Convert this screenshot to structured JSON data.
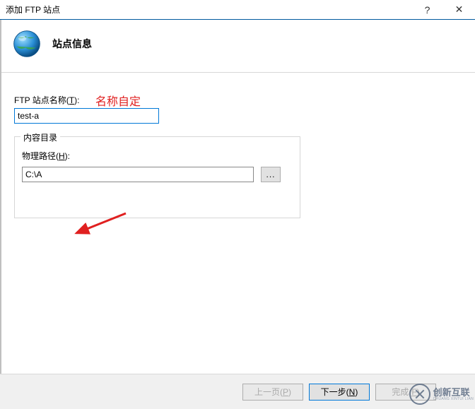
{
  "titlebar": {
    "title": "添加 FTP 站点",
    "help": "?",
    "close": "✕"
  },
  "header": {
    "title": "站点信息"
  },
  "annotation": "名称自定",
  "site_name": {
    "label_prefix": "FTP 站点名称(",
    "label_key": "T",
    "label_suffix": "):",
    "value": "test-a"
  },
  "content_dir": {
    "legend": "内容目录",
    "path_label_prefix": "物理路径(",
    "path_label_key": "H",
    "path_label_suffix": "):",
    "path_value": "C:\\A",
    "browse": "..."
  },
  "footer": {
    "prev_prefix": "上一页(",
    "prev_key": "P",
    "prev_suffix": ")",
    "next_prefix": "下一步(",
    "next_key": "N",
    "next_suffix": ")",
    "finish_prefix": "完成(",
    "finish_key": "F",
    "finish_suffix": ")"
  },
  "watermark": {
    "text": "创新互联",
    "sub": "CHUANG XINTUI LIAN"
  }
}
